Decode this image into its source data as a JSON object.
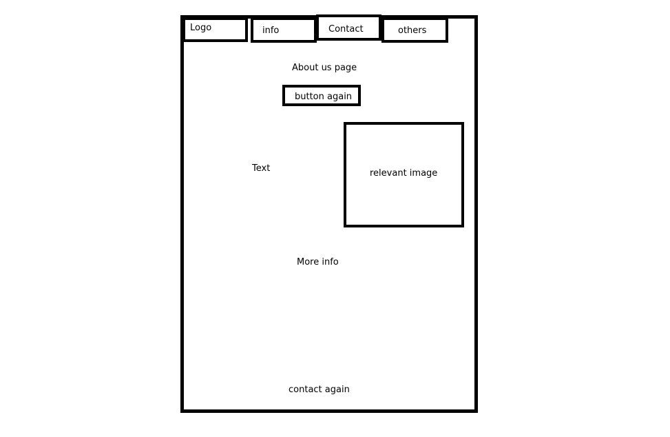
{
  "nav": {
    "logo": "Logo",
    "info": "info",
    "contact": "Contact",
    "others": "others"
  },
  "main": {
    "title": "About us page",
    "button_label": "button again",
    "text": "Text",
    "image_label": "relevant image",
    "more_info": "More info",
    "contact_again": "contact again"
  },
  "colors": {
    "stroke": "#000000",
    "background": "#ffffff"
  }
}
